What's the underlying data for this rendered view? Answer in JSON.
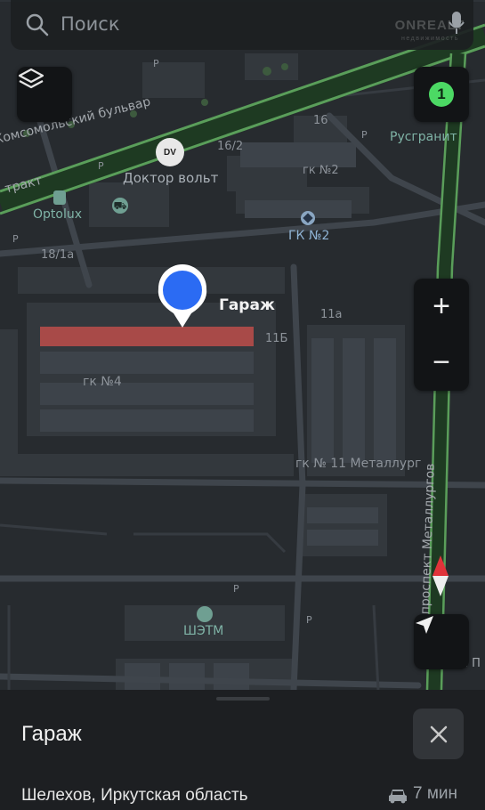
{
  "search": {
    "placeholder": "Поиск",
    "watermark": "ONREALT",
    "watermark_sub": "недвижимость"
  },
  "map": {
    "labels": {
      "komsomolsky": "Комсомольский бульвар",
      "trakt": "тракт",
      "doctor_volt": "Доктор вольт",
      "dv_logo": "DV",
      "n16_2": "16/2",
      "n16": "16",
      "rusgranit": "Русгранит",
      "gk2_small": "гк №2",
      "gk2": "ГК №2",
      "optolux": "Optolux",
      "n18_1a": "18/1а",
      "garage": "Гараж",
      "n11a": "11а",
      "n11b": "11Б",
      "gk4": "гк №4",
      "gk11": "гк № 11 Металлург",
      "metallurgov": "проспект Металлургов",
      "shetm": "ШЭТМ",
      "p": "P",
      "right_edge": "а П"
    },
    "layers_icon": "layers-icon",
    "badge_count": "1"
  },
  "controls": {
    "zoom_in": "+",
    "zoom_out": "−"
  },
  "place": {
    "title": "Гараж",
    "address": "Шелехов, Иркутская область",
    "travel_time": "7 мин",
    "transport_icon": "car-icon"
  },
  "colors": {
    "accent_pin": "#2b6bf3",
    "badge": "#4cd964",
    "highlight_building": "#a84a48",
    "road_green": "#5a9e5a"
  }
}
